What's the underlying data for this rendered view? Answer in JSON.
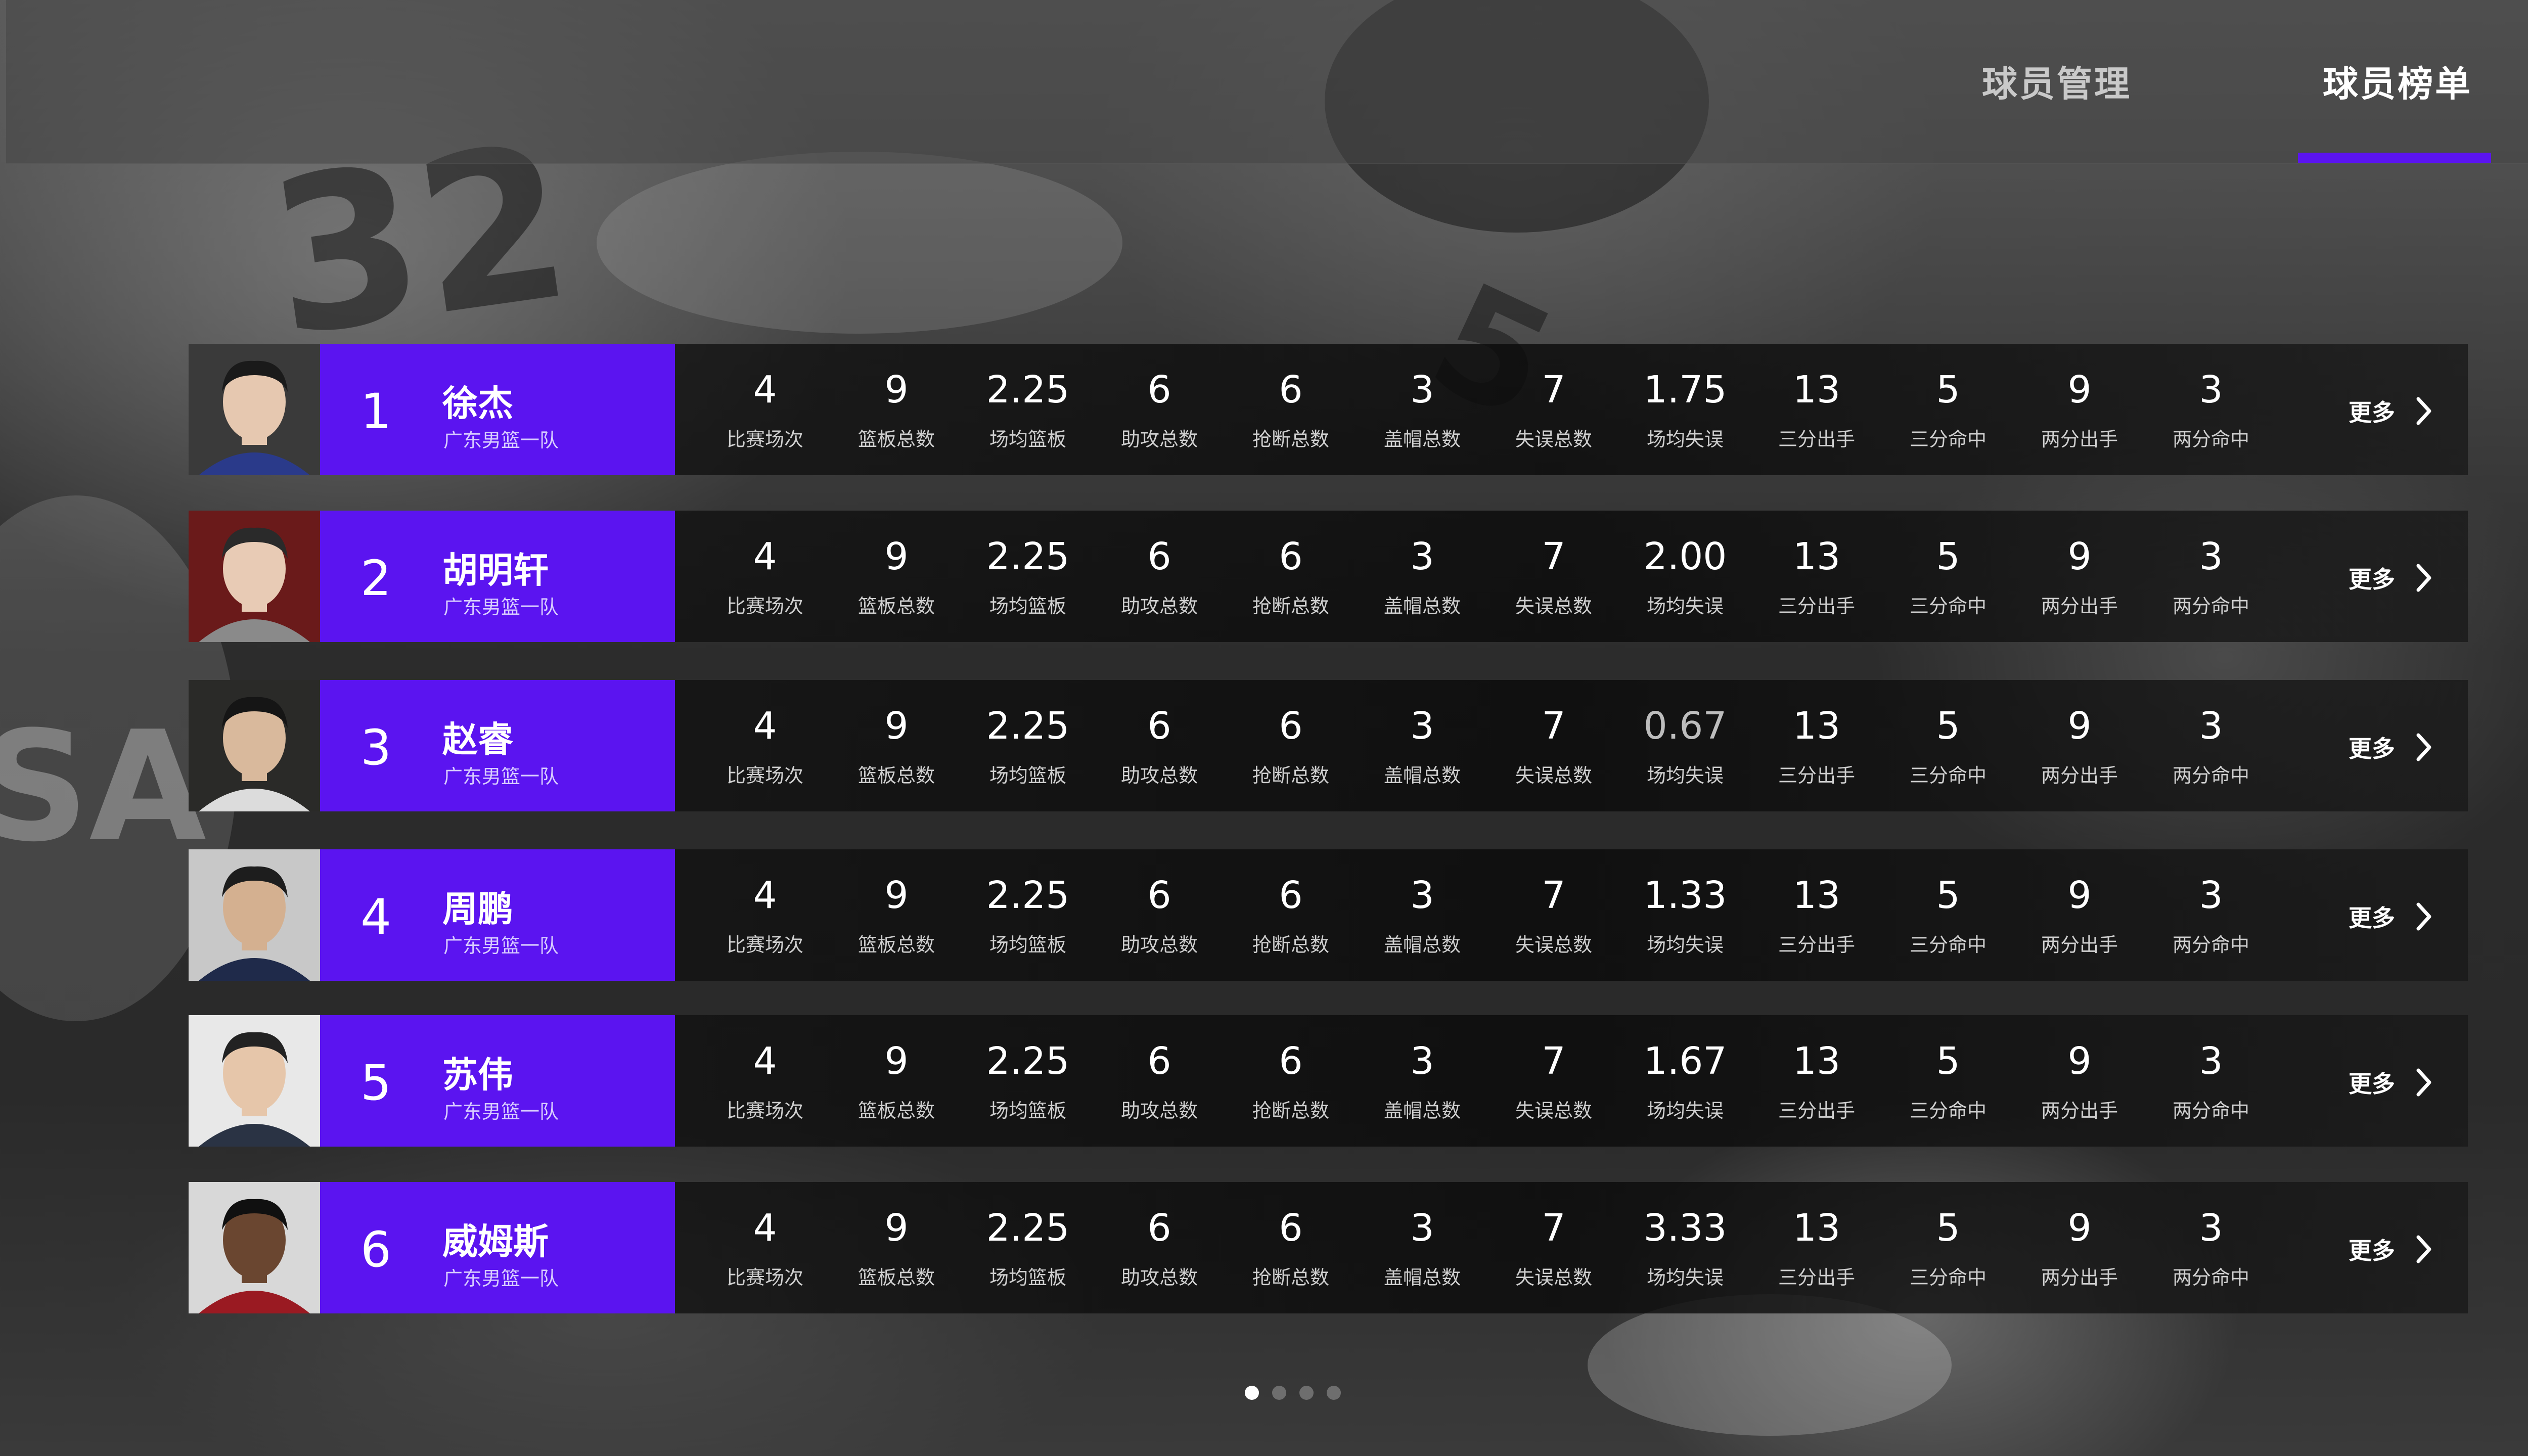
{
  "tabs": [
    {
      "label": "球员管理",
      "active": false
    },
    {
      "label": "球员榜单",
      "active": true
    }
  ],
  "accent_color": "#5b14f0",
  "stat_labels": [
    "比赛场次",
    "篮板总数",
    "场均篮板",
    "助攻总数",
    "抢断总数",
    "盖帽总数",
    "失误总数",
    "场均失误",
    "三分出手",
    "三分命中",
    "两分出手",
    "两分命中"
  ],
  "more_label": "更多",
  "players": [
    {
      "rank": "1",
      "name": "徐杰",
      "team": "广东男篮一队",
      "stats": [
        "4",
        "9",
        "2.25",
        "6",
        "6",
        "3",
        "7",
        "1.75",
        "13",
        "5",
        "9",
        "3"
      ]
    },
    {
      "rank": "2",
      "name": "胡明轩",
      "team": "广东男篮一队",
      "stats": [
        "4",
        "9",
        "2.25",
        "6",
        "6",
        "3",
        "7",
        "2.00",
        "13",
        "5",
        "9",
        "3"
      ]
    },
    {
      "rank": "3",
      "name": "赵睿",
      "team": "广东男篮一队",
      "stats": [
        "4",
        "9",
        "2.25",
        "6",
        "6",
        "3",
        "7",
        "0.67",
        "13",
        "5",
        "9",
        "3"
      ]
    },
    {
      "rank": "4",
      "name": "周鹏",
      "team": "广东男篮一队",
      "stats": [
        "4",
        "9",
        "2.25",
        "6",
        "6",
        "3",
        "7",
        "1.33",
        "13",
        "5",
        "9",
        "3"
      ]
    },
    {
      "rank": "5",
      "name": "苏伟",
      "team": "广东男篮一队",
      "stats": [
        "4",
        "9",
        "2.25",
        "6",
        "6",
        "3",
        "7",
        "1.67",
        "13",
        "5",
        "9",
        "3"
      ]
    },
    {
      "rank": "6",
      "name": "威姆斯",
      "team": "广东男篮一队",
      "stats": [
        "4",
        "9",
        "2.25",
        "6",
        "6",
        "3",
        "7",
        "3.33",
        "13",
        "5",
        "9",
        "3"
      ]
    }
  ],
  "icons": {
    "more": "chevron-right-icon"
  },
  "pager": {
    "pages": 4,
    "current": 1
  }
}
